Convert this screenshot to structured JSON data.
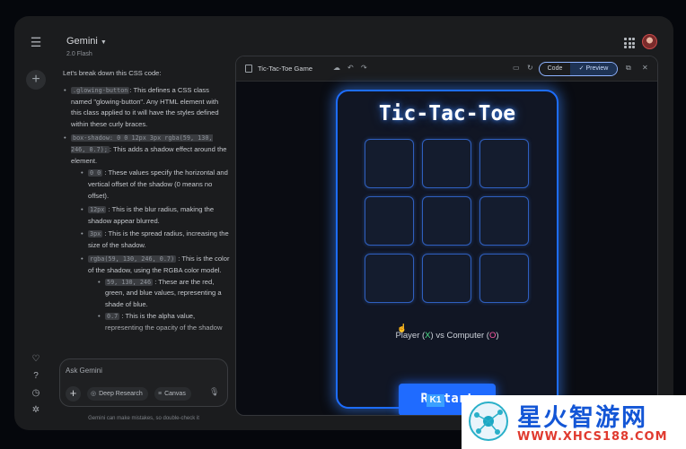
{
  "header": {
    "app_name": "Gemini",
    "model": "2.0 Flash"
  },
  "chat": {
    "intro": "Let's break down this CSS code:",
    "bullets": [
      {
        "code": ".glowing-button",
        "text": ": This defines a CSS class named \"glowing-button\". Any HTML element with this class applied to it will have the styles defined within these curly braces."
      },
      {
        "code": "box-shadow: 0 0 12px 3px rgba(59, 130, 246, 0.7);",
        "text": ": This adds a shadow effect around the element.",
        "sub": [
          {
            "code": "0 0",
            "text": " : These values specify the horizontal and vertical offset of the shadow (0 means no offset)."
          },
          {
            "code": "12px",
            "text": " : This is the blur radius, making the shadow appear blurred."
          },
          {
            "code": "3px",
            "text": " : This is the spread radius, increasing the size of the shadow."
          },
          {
            "code": "rgba(59, 130, 246, 0.7)",
            "text": " : This is the color of the shadow, using the RGBA color model.",
            "sub": [
              {
                "code": "59, 130, 246",
                "text": " : These are the red, green, and blue values, representing a shade of blue."
              },
              {
                "code": "0.7",
                "text": " : This is the alpha value, representing the opacity of the shadow"
              }
            ]
          }
        ]
      }
    ]
  },
  "input": {
    "placeholder": "Ask Gemini",
    "deep_research_label": "Deep Research",
    "canvas_label": "Canvas",
    "disclaimer": "Gemini can make mistakes, so double-check it"
  },
  "canvas": {
    "title": "Tic-Tac-Toe Game",
    "code_label": "Code",
    "preview_label": "Preview"
  },
  "game": {
    "title": "Tic-Tac-Toe",
    "status_prefix": "Player (",
    "player_mark": "X",
    "status_middle": ") vs Computer (",
    "computer_mark": "O",
    "status_suffix": ")",
    "restart_label": "Restart",
    "overlay_badge": "K1",
    "cells": [
      "",
      "",
      "",
      "",
      "",
      "",
      "",
      "",
      ""
    ]
  },
  "watermark": {
    "brand": "星火智游网",
    "url": "WWW.XHCS188.COM"
  },
  "colors": {
    "accent": "#1f6bff",
    "player_mark": "#4ee08a",
    "computer_mark": "#ff5aa5",
    "glow": "#3b82f6"
  },
  "icons": [
    "menu-icon",
    "plus-icon",
    "gem-icon",
    "help-icon",
    "history-icon",
    "settings-icon",
    "apps-icon",
    "share-icon",
    "undo-icon",
    "redo-icon",
    "console-icon",
    "refresh-icon",
    "copy-icon",
    "close-icon",
    "mic-icon"
  ]
}
